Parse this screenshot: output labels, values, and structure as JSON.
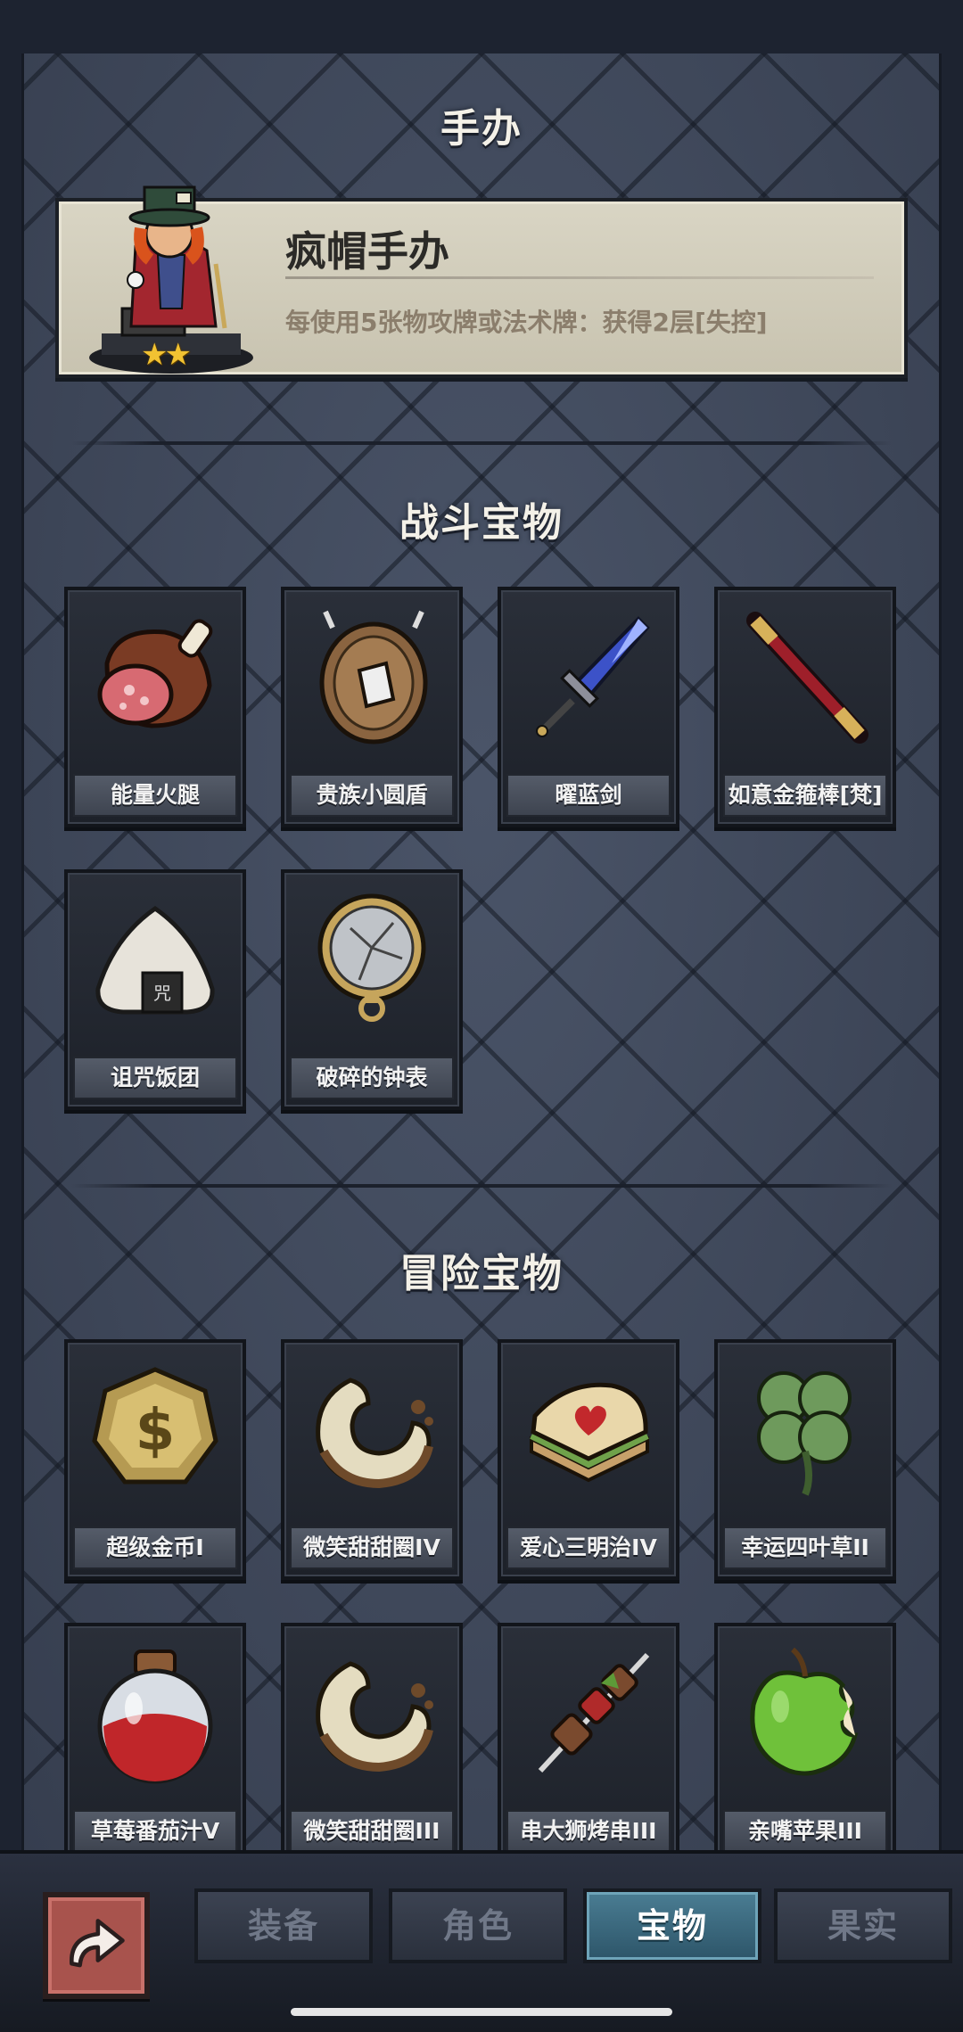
{
  "page_title": "手办",
  "featured": {
    "name": "疯帽手办",
    "description": "每使用5张物攻牌或法术牌：获得2层[失控]",
    "stars": "★★"
  },
  "sections": {
    "combat": {
      "title": "战斗宝物",
      "items": [
        {
          "label": "能量火腿",
          "icon": "ham-icon"
        },
        {
          "label": "贵族小圆盾",
          "icon": "round-shield-icon"
        },
        {
          "label": "曜蓝剑",
          "icon": "blue-sword-icon"
        },
        {
          "label": "如意金箍棒[梵]",
          "icon": "golden-staff-icon"
        },
        {
          "label": "诅咒饭团",
          "icon": "rice-ball-icon"
        },
        {
          "label": "破碎的钟表",
          "icon": "broken-pocket-watch-icon"
        }
      ]
    },
    "adventure": {
      "title": "冒险宝物",
      "items": [
        {
          "label": "超级金币I",
          "icon": "gold-coin-icon"
        },
        {
          "label": "微笑甜甜圈IV",
          "icon": "donut-icon"
        },
        {
          "label": "爱心三明治IV",
          "icon": "heart-sandwich-icon"
        },
        {
          "label": "幸运四叶草II",
          "icon": "four-leaf-clover-icon"
        },
        {
          "label": "草莓番茄汁V",
          "icon": "juice-flask-icon"
        },
        {
          "label": "微笑甜甜圈III",
          "icon": "donut-icon"
        },
        {
          "label": "串大狮烤串III",
          "icon": "kebab-icon"
        },
        {
          "label": "亲嘴苹果III",
          "icon": "bitten-apple-icon"
        }
      ]
    }
  },
  "tabs": [
    {
      "label": "装备",
      "active": false
    },
    {
      "label": "角色",
      "active": false
    },
    {
      "label": "宝物",
      "active": true
    },
    {
      "label": "果实",
      "active": false
    }
  ],
  "colors": {
    "tab_active": "#3d6b80",
    "panel": "#3d4658",
    "back_button": "#a8534d"
  }
}
